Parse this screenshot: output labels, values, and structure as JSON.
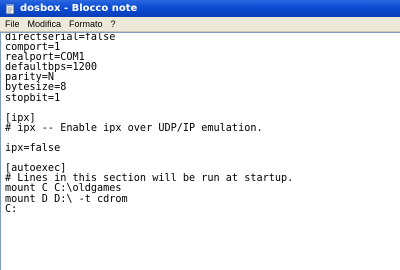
{
  "window": {
    "title": "dosbox - Blocco note"
  },
  "menu": {
    "items": [
      "File",
      "Modifica",
      "Formato",
      "?"
    ]
  },
  "editor": {
    "lines": [
      "directserial=false",
      "comport=1",
      "realport=COM1",
      "defaultbps=1200",
      "parity=N",
      "bytesize=8",
      "stopbit=1",
      "",
      "[ipx]",
      "# ipx -- Enable ipx over UDP/IP emulation.",
      "",
      "ipx=false",
      "",
      "[autoexec]",
      "# Lines in this section will be run at startup.",
      "mount C C:\\oldgames",
      "mount D D:\\ -t cdrom",
      "C:"
    ]
  },
  "icons": {
    "app": "notepad-icon"
  }
}
